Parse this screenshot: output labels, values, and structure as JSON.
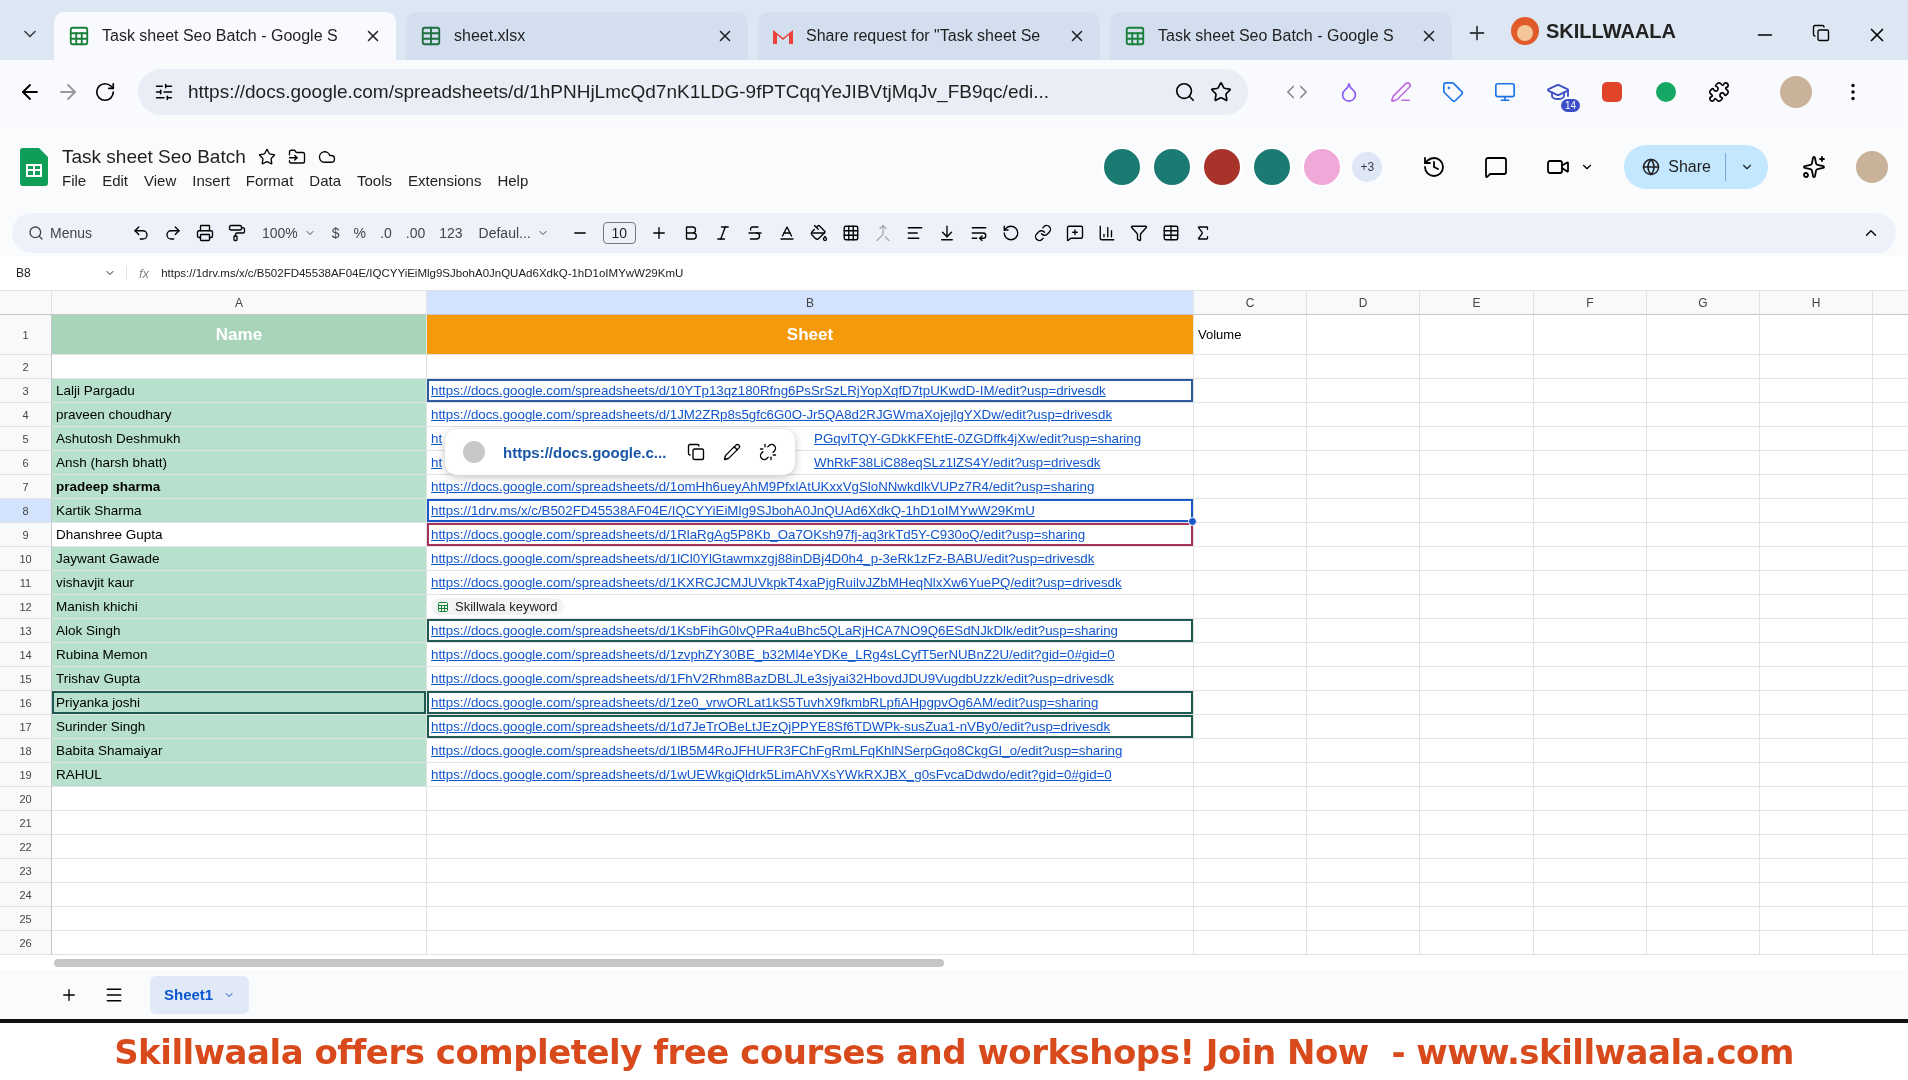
{
  "browser": {
    "tabs": [
      {
        "title": "Task sheet Seo Batch - Google S",
        "kind": "sheets",
        "selected": true
      },
      {
        "title": "sheet.xlsx",
        "kind": "excel",
        "selected": false
      },
      {
        "title": "Share request for \"Task sheet Se",
        "kind": "gmail",
        "selected": false
      },
      {
        "title": "Task sheet Seo Batch - Google S",
        "kind": "sheets",
        "selected": false
      }
    ],
    "url": "https://docs.google.com/spreadsheets/d/1hPNHjLmcQd7nK1LDG-9fPTCqqYeJIBVtjMqJv_FB9qc/edi...",
    "brand": "SKILLWAALA",
    "extension_badge": "14"
  },
  "doc": {
    "title": "Task sheet Seo Batch",
    "menu": [
      "File",
      "Edit",
      "View",
      "Insert",
      "Format",
      "Data",
      "Tools",
      "Extensions",
      "Help"
    ],
    "collaborators": [
      {
        "color": "#1b7a72"
      },
      {
        "color": "#1b7a72"
      },
      {
        "color": "#a8332b"
      },
      {
        "color": "#1b7a72"
      },
      {
        "color": "#f0a8d8"
      }
    ],
    "collaborators_more": "+3",
    "share": "Share"
  },
  "toolbar": {
    "search": "Menus",
    "zoom": "100%",
    "currency": "$",
    "percent": "%",
    "decrease_decimals": ".0",
    "increase_decimals": ".00",
    "number_format": "123",
    "font": "Defaul...",
    "font_size": "10"
  },
  "formula_bar": {
    "cell_ref": "B8",
    "function_label": "fx",
    "value": "https://1drv.ms/x/c/B502FD45538AF04E/IQCYYiEiMlg9SJbohA0JnQUAd6XdkQ-1hD1oIMYwW29KmU"
  },
  "sheet": {
    "columns": [
      {
        "label": "A",
        "selected": false
      },
      {
        "label": "B",
        "selected": true
      },
      {
        "label": "C",
        "selected": false
      },
      {
        "label": "D",
        "selected": false
      },
      {
        "label": "E",
        "selected": false
      },
      {
        "label": "F",
        "selected": false
      },
      {
        "label": "G",
        "selected": false
      },
      {
        "label": "H",
        "selected": false
      }
    ],
    "rows": [
      {
        "num": "1",
        "kind": "header",
        "name": "Name",
        "link": "Sheet",
        "volume": "Volume",
        "selected": false
      },
      {
        "num": "2",
        "kind": "empty",
        "selected": false
      },
      {
        "num": "3",
        "kind": "link",
        "name": "Lalji Pargadu",
        "bold": false,
        "highlighted": true,
        "link": "https://docs.google.com/spreadsheets/d/10YTp13qz180Rfng6PsSrSzLRjYopXqfD7tpUKwdD-IM/edit?usp=drivesdk",
        "color": "#2d5a9e",
        "selected": false
      },
      {
        "num": "4",
        "kind": "link",
        "name": "praveen choudhary",
        "bold": false,
        "highlighted": true,
        "link": "https://docs.google.com/spreadsheets/d/1JM2ZRp8s5gfc6G0O-Jr5QA8d2RJGWmaXojejlgYXDw/edit?usp=drivesdk",
        "selected": false
      },
      {
        "num": "5",
        "kind": "partial",
        "name": "Ashutosh Deshmukh",
        "bold": false,
        "highlighted": true,
        "link_start": "ht",
        "link_end": "PGqvlTQY-GDkKFEhtE-0ZGDffk4jXw/edit?usp=sharing",
        "selected": false
      },
      {
        "num": "6",
        "kind": "partial",
        "name": "Ansh (harsh bhatt)",
        "bold": false,
        "highlighted": true,
        "link_start": "ht",
        "link_end": "WhRkF38LiC88eqSLz1lZS4Y/edit?usp=drivesdk",
        "selected": false
      },
      {
        "num": "7",
        "kind": "link",
        "name": "pradeep sharma",
        "bold": true,
        "highlighted": true,
        "link": "https://docs.google.com/spreadsheets/d/1omHh6ueyAhM9PfxlAtUKxxVgSloNNwkdlkVUPz7R4/edit?usp=sharing",
        "selected": false
      },
      {
        "num": "8",
        "kind": "link",
        "name": "Kartik Sharma",
        "bold": false,
        "highlighted": true,
        "link": "https://1drv.ms/x/c/B502FD45538AF04E/IQCYYiEiMlg9SJbohA0JnQUAd6XdkQ-1hD1oIMYwW29KmU",
        "color": "#1a57c8",
        "selected": true
      },
      {
        "num": "9",
        "kind": "link",
        "name": "Dhanshree Gupta",
        "bold": false,
        "highlighted": false,
        "link": "https://docs.google.com/spreadsheets/d/1RlaRgAg5P8Kb_Oa7OKsh97fj-aq3rkTd5Y-C930oQ/edit?usp=sharing",
        "color": "#a8325e",
        "selected": false
      },
      {
        "num": "10",
        "kind": "link",
        "name": "Jaywant Gawade",
        "bold": false,
        "highlighted": true,
        "link": "https://docs.google.com/spreadsheets/d/1lCl0YlGtawmxzgj88inDBj4D0h4_p-3eRk1zFz-BABU/edit?usp=drivesdk",
        "selected": false
      },
      {
        "num": "11",
        "kind": "link",
        "name": "vishavjit kaur",
        "bold": false,
        "highlighted": true,
        "link": "https://docs.google.com/spreadsheets/d/1KXRCJCMJUVkpkT4xaPjgRuilvJZbMHeqNlxXw6YuePQ/edit?usp=drivesdk",
        "selected": false
      },
      {
        "num": "12",
        "kind": "chip",
        "name": "Manish khichi",
        "bold": false,
        "highlighted": true,
        "chip": "Skillwala keyword",
        "selected": false
      },
      {
        "num": "13",
        "kind": "link",
        "name": "Alok Singh",
        "bold": false,
        "highlighted": true,
        "link": "https://docs.google.com/spreadsheets/d/1KsbFihG0lvQPRa4uBhc5QLaRjHCA7NO9Q6ESdNJkDlk/edit?usp=sharing",
        "color": "#1f5a52",
        "selected": false
      },
      {
        "num": "14",
        "kind": "link",
        "name": "Rubina Memon",
        "bold": false,
        "highlighted": true,
        "link": "https://docs.google.com/spreadsheets/d/1zvphZY30BE_b32Ml4eYDKe_LRg4sLCyfT5erNUBnZ2U/edit?gid=0#gid=0",
        "selected": false
      },
      {
        "num": "15",
        "kind": "link",
        "name": "Trishav Gupta",
        "bold": false,
        "highlighted": true,
        "link": "https://docs.google.com/spreadsheets/d/1FhV2Rhm8BazDBLJLe3sjyai32HbovdJDU9VugdbUzzk/edit?usp=drivesdk",
        "selected": false
      },
      {
        "num": "16",
        "kind": "link",
        "name": "Priyanka joshi",
        "bold": false,
        "highlighted": true,
        "link": "https://docs.google.com/spreadsheets/d/1ze0_vrwORLat1kS5TuvhX9fkmbRLpfiAHpgpvOg6AM/edit?usp=sharing",
        "color": "#1f5a52",
        "outline_whole_row": true,
        "selected": false
      },
      {
        "num": "17",
        "kind": "link",
        "name": "Surinder Singh",
        "bold": false,
        "highlighted": true,
        "link": "https://docs.google.com/spreadsheets/d/1d7JeTrOBeLtJEzQjPPYE8Sf6TDWPk-susZua1-nVBy0/edit?usp=drivesdk",
        "color": "#1f5a52",
        "selected": false
      },
      {
        "num": "18",
        "kind": "link",
        "name": "Babita Shamaiyar",
        "bold": false,
        "highlighted": true,
        "link": "https://docs.google.com/spreadsheets/d/1lB5M4RoJFHUFR3FChFgRmLFqKhlNSerpGqo8CkgGI_o/edit?usp=sharing",
        "selected": false
      },
      {
        "num": "19",
        "kind": "link",
        "name": "RAHUL",
        "bold": false,
        "highlighted": true,
        "link": "https://docs.google.com/spreadsheets/d/1wUEWkgiQldrk5LimAhVXsYWkRXJBX_g0sFvcaDdwdo/edit?gid=0#gid=0",
        "selected": false
      },
      {
        "num": "20",
        "kind": "empty",
        "selected": false
      },
      {
        "num": "21",
        "kind": "empty",
        "selected": false
      },
      {
        "num": "22",
        "kind": "empty",
        "selected": false
      },
      {
        "num": "23",
        "kind": "empty",
        "selected": false
      },
      {
        "num": "24",
        "kind": "empty",
        "selected": false
      },
      {
        "num": "25",
        "kind": "empty",
        "selected": false
      },
      {
        "num": "26",
        "kind": "empty",
        "selected": false
      }
    ]
  },
  "link_popup": {
    "url": "https://docs.google.c..."
  },
  "sheet_tabs": [
    {
      "label": "Sheet1",
      "selected": true
    }
  ],
  "banner": "Skillwaala offers completely free courses and workshops! Join Now  - www.skillwaala.com"
}
